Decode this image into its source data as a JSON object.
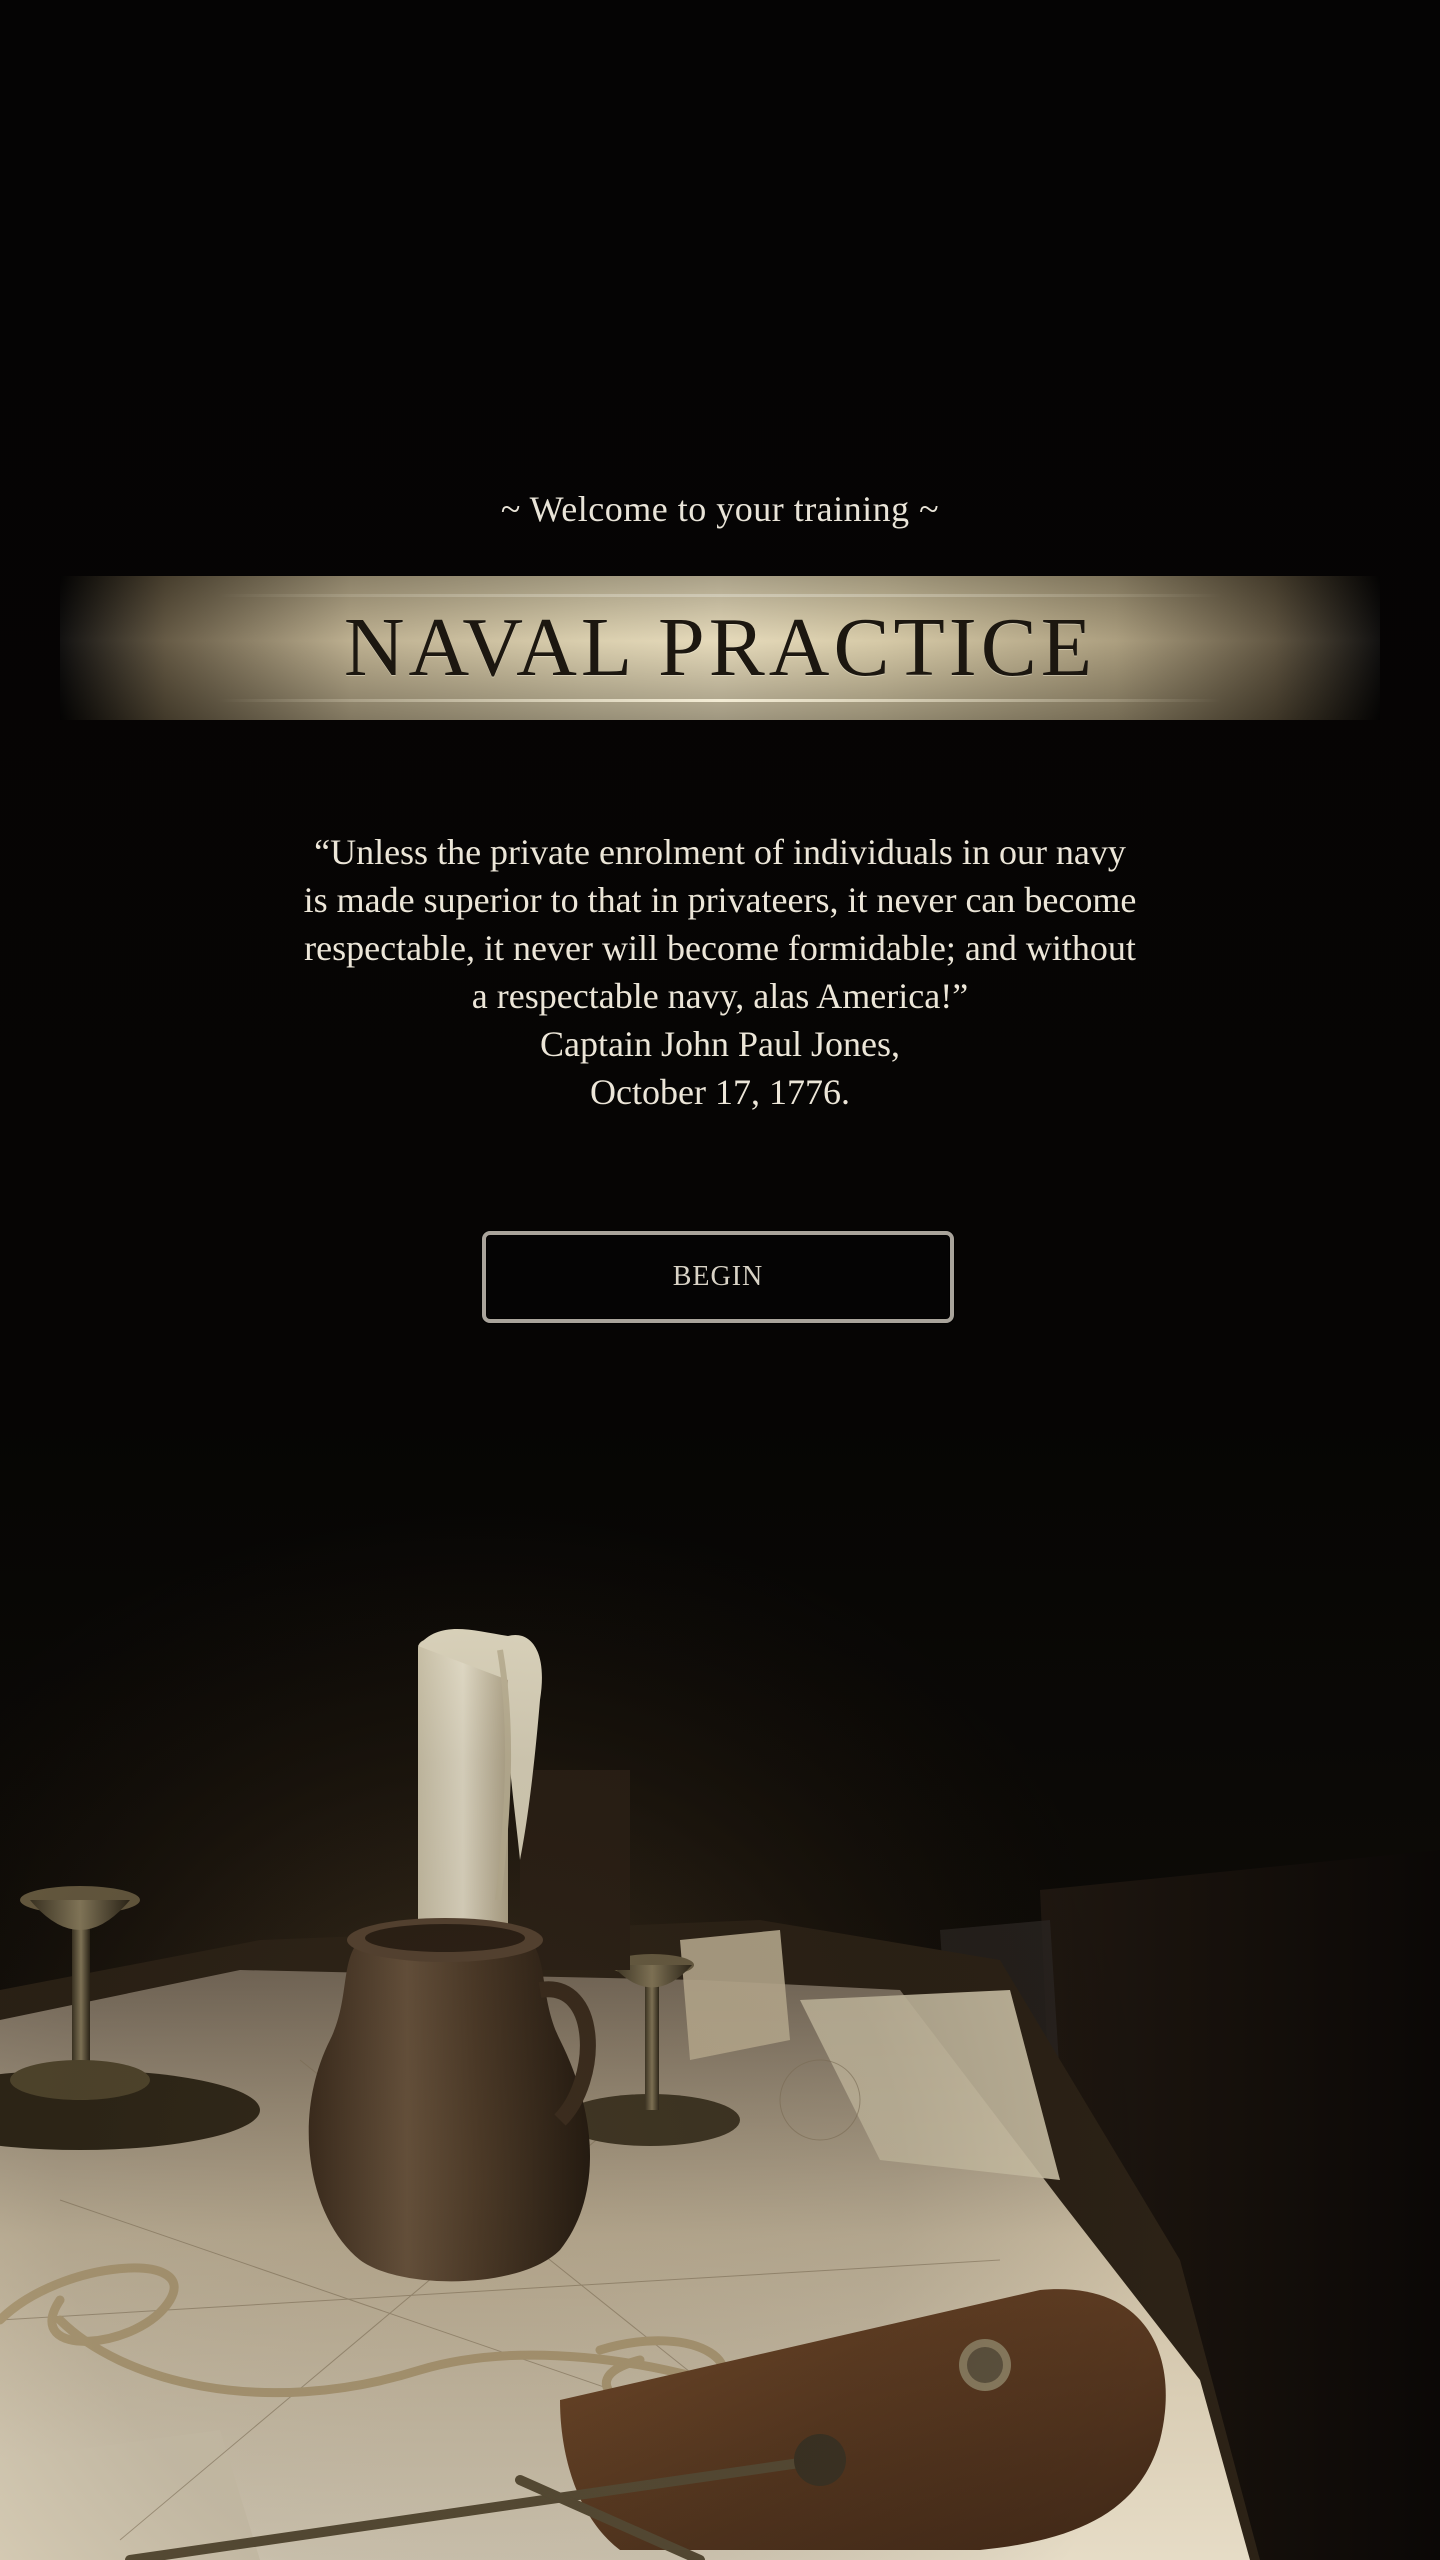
{
  "header": {
    "welcome": "~ Welcome to your training ~",
    "title": "NAVAL PRACTICE"
  },
  "quote": {
    "lines": [
      "“Unless the private enrolment of individuals in our navy",
      "is made superior to that in privateers, it never can become",
      "respectable, it never will become formidable; and without",
      "a respectable navy, alas America!”"
    ],
    "author": "Captain John Paul Jones,",
    "date": "October 17, 1776."
  },
  "actions": {
    "begin_label": "BEGIN"
  },
  "colors": {
    "background": "#060504",
    "text": "#ece6d8",
    "banner_gold": "#d8ccaa",
    "banner_text": "#1c1710",
    "button_border": "#a9a49b"
  }
}
